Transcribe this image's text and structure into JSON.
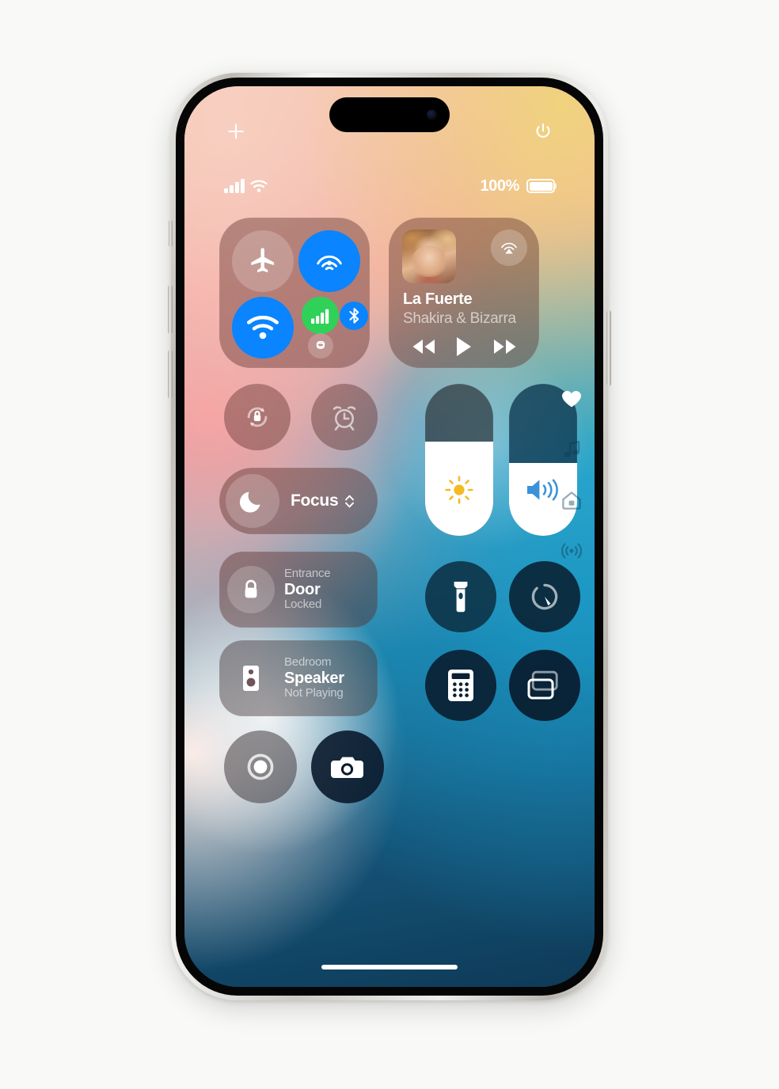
{
  "device": {
    "name": "iphone-15-pro",
    "frame_color": "#d8d5cf",
    "canvas_background": "#f9f9f8"
  },
  "screen": {
    "wallpaper_colors": [
      "#f0d27e",
      "#f7cfc0",
      "#f5a0a0",
      "#23a4cd",
      "#15557a",
      "#0e3a57"
    ],
    "dynamic_island": {
      "camera_icon": "front-camera-dot"
    }
  },
  "top_chrome": {
    "add_control_icon": "plus-icon",
    "add_control_label": "+",
    "power_icon": "power-icon"
  },
  "status_bar": {
    "signal_icon": "cellular-signal-icon",
    "signal_bars_active": 4,
    "wifi_icon": "wifi-icon",
    "battery_percent": "100%",
    "battery_icon": "battery-icon",
    "battery_level": 100
  },
  "connectivity": {
    "airplane": {
      "label": "Airplane Mode",
      "icon": "airplane-icon",
      "active": false,
      "color": "#ffffff"
    },
    "airdrop": {
      "label": "AirDrop",
      "icon": "airdrop-icon",
      "active": true,
      "color": "#0a84ff"
    },
    "wifi": {
      "label": "Wi-Fi",
      "icon": "wifi-icon",
      "active": true,
      "color": "#0a84ff"
    },
    "cellular": {
      "label": "Cellular Data",
      "icon": "cellular-bars-icon",
      "active": true,
      "color": "#30d158"
    },
    "bluetooth": {
      "label": "Bluetooth",
      "icon": "bluetooth-icon",
      "active": true,
      "color": "#0a84ff"
    },
    "hotspot": {
      "label": "Personal Hotspot",
      "icon": "hotspot-link-icon",
      "active": false,
      "color": "#ffffff"
    }
  },
  "now_playing": {
    "track_title": "La Fuerte",
    "track_artist": "Shakira & Bizarra",
    "album_art_alt": "album-artwork",
    "airplay_icon": "airplay-audio-icon",
    "controls": {
      "rewind_icon": "rewind-icon",
      "play_icon": "play-icon",
      "forward_icon": "fast-forward-icon"
    },
    "playback_state": "paused"
  },
  "quick_toggles": {
    "rotation_lock": {
      "label": "Rotation Lock",
      "icon": "rotation-lock-icon",
      "active": false
    },
    "alarm": {
      "label": "Alarm",
      "icon": "alarm-clock-icon",
      "active": false
    }
  },
  "focus": {
    "label": "Focus",
    "icon": "moon-icon",
    "chevron_icon": "chevron-up-down-icon",
    "active": false
  },
  "home_accessories": [
    {
      "room": "Entrance",
      "name": "Door",
      "state": "Locked",
      "icon": "lock-closed-icon"
    },
    {
      "room": "Bedroom",
      "name": "Speaker",
      "state": "Not Playing",
      "icon": "speaker-box-icon"
    }
  ],
  "sliders": {
    "brightness": {
      "label": "Brightness",
      "icon": "sun-icon",
      "icon_color": "#f5b922",
      "value_percent": 62
    },
    "volume": {
      "label": "Volume",
      "icon": "speaker-waves-icon",
      "icon_color": "#3b92d8",
      "value_percent": 48
    }
  },
  "utilities": [
    {
      "name": "Flashlight",
      "icon": "flashlight-icon",
      "active": false
    },
    {
      "name": "Timer",
      "icon": "timer-icon",
      "active": false
    },
    {
      "name": "Calculator",
      "icon": "calculator-icon",
      "active": false
    },
    {
      "name": "Screen Mirroring",
      "icon": "screen-mirroring-icon",
      "active": false
    }
  ],
  "capture": [
    {
      "name": "Screen Recording",
      "icon": "screen-record-icon",
      "active": false
    },
    {
      "name": "Camera",
      "icon": "camera-icon",
      "active": false
    }
  ],
  "page_rail": [
    {
      "name": "Favorites",
      "icon": "heart-icon",
      "active": true
    },
    {
      "name": "Media",
      "icon": "music-note-icon",
      "active": false
    },
    {
      "name": "Home",
      "icon": "house-icon",
      "active": false
    },
    {
      "name": "Connectivity",
      "icon": "broadcast-icon",
      "active": false
    }
  ],
  "home_indicator": {
    "name": "home-indicator"
  }
}
